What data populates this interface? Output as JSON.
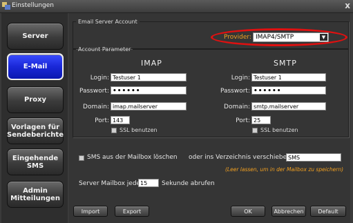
{
  "window": {
    "title": "Einstellungen",
    "close_glyph": "x",
    "icon": "app-icon"
  },
  "sidebar": {
    "items": [
      {
        "label": "Server"
      },
      {
        "label": "E-Mail",
        "active": true
      },
      {
        "label": "Proxy"
      },
      {
        "label": "Vorlagen für Sendeberichte"
      },
      {
        "label": "Eingehende SMS"
      },
      {
        "label": "Admin Mitteilungen"
      }
    ]
  },
  "email_server": {
    "legend": "Email Server Account",
    "provider_label": "Provider:",
    "provider_value": "IMAP4/SMTP",
    "highlight_color": "#e01010"
  },
  "account": {
    "legend": "Account Parameter",
    "imap": {
      "heading": "IMAP",
      "login_label": "Login:",
      "login": "Testuser 1",
      "password_label": "Passwort:",
      "password": "••••••",
      "domain_label": "Domain:",
      "domain": "imap.mailserver",
      "port_label": "Port:",
      "port": "143",
      "ssl_label": "SSL benutzen"
    },
    "smtp": {
      "heading": "SMTP",
      "login_label": "Login:",
      "login": "Testuser 1",
      "password_label": "Passwort:",
      "password": "••••••",
      "domain_label": "Domain:",
      "domain": "smtp.mailserver",
      "port_label": "Port:",
      "port": "25",
      "ssl_label": "SSL benutzen"
    }
  },
  "mailbox": {
    "sms_delete_label": "SMS aus der Mailbox löschen",
    "move_label": "oder ins Verzeichnis verschieben:",
    "move_value": "SMS",
    "move_hint": "(Leer lassen, um in der Mailbox zu speichern)",
    "poll_prefix": "Server Mailbox jede",
    "poll_value": "15",
    "poll_suffix": "Sekunde abrufen"
  },
  "buttons": {
    "import": "Import",
    "export": "Export",
    "ok": "OK",
    "cancel": "Abbrechen",
    "default": "Default"
  }
}
